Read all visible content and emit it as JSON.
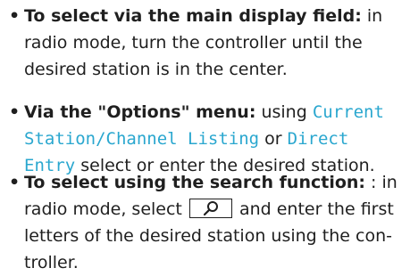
{
  "items": [
    {
      "bullet": "•",
      "lines": [
        {
          "lead": "To select via the main display field:",
          "text": " in"
        },
        {
          "text": "radio mode, turn the controller until the"
        },
        {
          "text": "desired station is in the center."
        }
      ]
    },
    {
      "bullet": "•",
      "lines": [
        {
          "lead": "Via the \"Options\" menu:",
          "text": " using ",
          "term": "Current"
        },
        {
          "term": "Station/Channel Listing",
          "text": " or ",
          "term2": "Direct"
        },
        {
          "term": "Entry",
          "text": " select or enter the desired station."
        }
      ]
    },
    {
      "bullet": "•",
      "lines": [
        {
          "lead": "To select using the search function:",
          "text": " : in"
        },
        {
          "text_before": "radio mode, select ",
          "icon": "search-icon",
          "text": " and enter the first"
        },
        {
          "text": "letters of the desired station using the con-"
        },
        {
          "text": "troller."
        }
      ]
    }
  ]
}
